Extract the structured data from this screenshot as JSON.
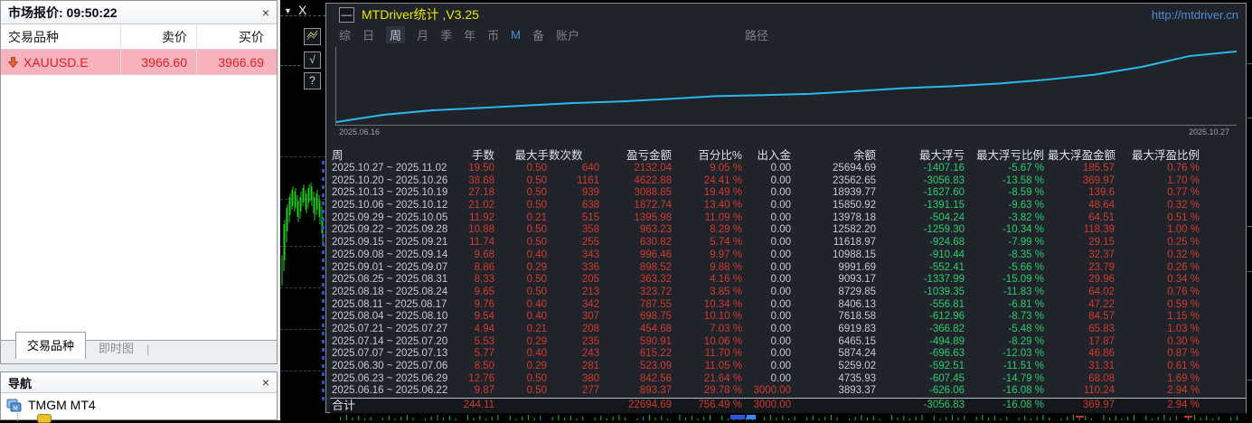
{
  "icons": {
    "close": "×",
    "minimize": "—",
    "dropdown": "▼",
    "window_close": "X",
    "check": "√",
    "help": "?"
  },
  "colors": {
    "accent_red": "#cf3a30",
    "accent_green": "#27cd6e",
    "equity_line": "#29b9ea",
    "title_yellow": "#e8e800",
    "url_blue": "#4a8fd4",
    "quote_row_pink": "#f8b2bd",
    "quote_red": "#de2020"
  },
  "market_watch": {
    "title": "市场报价: 09:50:22",
    "columns": [
      "交易品种",
      "卖价",
      "买价"
    ],
    "quote": {
      "symbol": "XAUUSD.E",
      "sell": "3966.60",
      "buy": "3966.69"
    },
    "tabs": {
      "active": "交易品种",
      "inactive": "即时图"
    }
  },
  "navigator": {
    "title": "导航",
    "items": [
      {
        "label": "TMGM MT4"
      }
    ]
  },
  "mtdriver": {
    "title": "MTDriver统计 ,V3.25",
    "url": "http://mtdriver.cn",
    "toolbar": [
      "综",
      "日",
      "周",
      "月",
      "季",
      "年",
      "币",
      "M",
      "备",
      "账户"
    ],
    "toolbar_active": "周",
    "toolbar_path": "路径",
    "chart_dates": {
      "start": "2025.06.16",
      "end": "2025.10.27"
    },
    "table": {
      "headers": [
        {
          "label": "周",
          "span": 1
        },
        {
          "label": "手数",
          "span": 1
        },
        {
          "label": "最大手数次数",
          "span": 2
        },
        {
          "label": "盈亏金额",
          "span": 1
        },
        {
          "label": "百分比%",
          "span": 1
        },
        {
          "label": "出入金",
          "span": 1
        },
        {
          "label": "余额",
          "span": 1
        },
        {
          "label": "最大浮亏",
          "span": 1
        },
        {
          "label": "最大浮亏比例",
          "span": 1
        },
        {
          "label": "最大浮盈金额",
          "span": 1
        },
        {
          "label": "最大浮盈比例",
          "span": 1
        }
      ],
      "col_classes": [
        "date",
        "red",
        "red",
        "red",
        "red",
        "red",
        "white",
        "white",
        "green",
        "green",
        "red",
        "red"
      ],
      "rows": [
        [
          "2025.10.27 ~ 2025.11.02",
          "19.50",
          "0.50",
          "640",
          "2132.04",
          "9.05 %",
          "0.00",
          "25694.69",
          "-1407.16",
          "-5.67 %",
          "185.57",
          "0.76 %"
        ],
        [
          "2025.10.20 ~ 2025.10.26",
          "38.68",
          "0.50",
          "1161",
          "4622.88",
          "24.41 %",
          "0.00",
          "23562.65",
          "-3056.83",
          "-13.58 %",
          "369.97",
          "1.70 %"
        ],
        [
          "2025.10.13 ~ 2025.10.19",
          "27.18",
          "0.50",
          "939",
          "3088.85",
          "19.49 %",
          "0.00",
          "18939.77",
          "-1627.60",
          "-8.59 %",
          "139.6",
          "0.77 %"
        ],
        [
          "2025.10.06 ~ 2025.10.12",
          "21.02",
          "0.50",
          "638",
          "1872.74",
          "13.40 %",
          "0.00",
          "15850.92",
          "-1391.15",
          "-9.63 %",
          "48.64",
          "0.32 %"
        ],
        [
          "2025.09.29 ~ 2025.10.05",
          "11.92",
          "0.21",
          "515",
          "1395.98",
          "11.09 %",
          "0.00",
          "13978.18",
          "-504.24",
          "-3.82 %",
          "64.51",
          "0.51 %"
        ],
        [
          "2025.09.22 ~ 2025.09.28",
          "10.88",
          "0.50",
          "358",
          "963.23",
          "8.29 %",
          "0.00",
          "12582.20",
          "-1259.30",
          "-10.34 %",
          "118.39",
          "1.00 %"
        ],
        [
          "2025.09.15 ~ 2025.09.21",
          "11.74",
          "0.50",
          "255",
          "630.82",
          "5.74 %",
          "0.00",
          "11618.97",
          "-924.68",
          "-7.99 %",
          "29.15",
          "0.25 %"
        ],
        [
          "2025.09.08 ~ 2025.09.14",
          "9.68",
          "0.40",
          "343",
          "996.46",
          "9.97 %",
          "0.00",
          "10988.15",
          "-910.44",
          "-8.35 %",
          "32.37",
          "0.32 %"
        ],
        [
          "2025.09.01 ~ 2025.09.07",
          "8.86",
          "0.29",
          "336",
          "898.52",
          "9.88 %",
          "0.00",
          "9991.69",
          "-552.41",
          "-5.66 %",
          "23.79",
          "0.26 %"
        ],
        [
          "2025.08.25 ~ 2025.08.31",
          "8.33",
          "0.50",
          "205",
          "363.32",
          "4.16 %",
          "0.00",
          "9093.17",
          "-1337.99",
          "-15.09 %",
          "29.96",
          "0.34 %"
        ],
        [
          "2025.08.18 ~ 2025.08.24",
          "9.65",
          "0.50",
          "213",
          "323.72",
          "3.85 %",
          "0.00",
          "8729.85",
          "-1039.35",
          "-11.83 %",
          "64.02",
          "0.76 %"
        ],
        [
          "2025.08.11 ~ 2025.08.17",
          "9.76",
          "0.40",
          "342",
          "787.55",
          "10.34 %",
          "0.00",
          "8406.13",
          "-556.81",
          "-6.81 %",
          "47.22",
          "0.59 %"
        ],
        [
          "2025.08.04 ~ 2025.08.10",
          "9.54",
          "0.40",
          "307",
          "698.75",
          "10.10 %",
          "0.00",
          "7618.58",
          "-612.96",
          "-8.73 %",
          "84.57",
          "1.15 %"
        ],
        [
          "2025.07.21 ~ 2025.07.27",
          "4.94",
          "0.21",
          "208",
          "454.68",
          "7.03 %",
          "0.00",
          "6919.83",
          "-366.82",
          "-5.48 %",
          "65.83",
          "1.03 %"
        ],
        [
          "2025.07.14 ~ 2025.07.20",
          "5.53",
          "0.29",
          "235",
          "590.91",
          "10.06 %",
          "0.00",
          "6465.15",
          "-494.89",
          "-8.29 %",
          "17.87",
          "0.30 %"
        ],
        [
          "2025.07.07 ~ 2025.07.13",
          "5.77",
          "0.40",
          "243",
          "615.22",
          "11.70 %",
          "0.00",
          "5874.24",
          "-696.63",
          "-12.03 %",
          "46.86",
          "0.87 %"
        ],
        [
          "2025.06.30 ~ 2025.07.06",
          "8.50",
          "0.29",
          "281",
          "523.09",
          "11.05 %",
          "0.00",
          "5259.02",
          "-592.51",
          "-11.51 %",
          "31.31",
          "0.61 %"
        ],
        [
          "2025.06.23 ~ 2025.06.29",
          "12.76",
          "0.50",
          "380",
          "842.56",
          "21.64 %",
          "0.00",
          "4735.93",
          "-607.45",
          "-14.79 %",
          "68.08",
          "1.69 %"
        ],
        [
          "2025.06.16 ~ 2025.06.22",
          "9.87",
          "0.50",
          "277",
          "893.37",
          "29.78 %",
          "3000.00",
          "3893.37",
          "-626.06",
          "-16.08 %",
          "110.24",
          "2.94 %"
        ]
      ],
      "total": [
        "合计",
        "244.11",
        "",
        "",
        "22694.69",
        "756.49 %",
        "3000.00",
        "",
        "-3056.83",
        "-16.08 %",
        "369.97",
        "2.94 %"
      ]
    }
  },
  "chart_data": {
    "type": "line",
    "title": "MTDriver equity curve",
    "line_color": "#29b9ea",
    "x_labels_shown": [
      "2025.06.16",
      "2025.10.27"
    ],
    "start_value": 3000.0,
    "x": [
      "2025.06.16",
      "2025.06.23",
      "2025.06.30",
      "2025.07.07",
      "2025.07.14",
      "2025.07.21",
      "2025.08.04",
      "2025.08.11",
      "2025.08.18",
      "2025.08.25",
      "2025.09.01",
      "2025.09.08",
      "2025.09.15",
      "2025.09.22",
      "2025.09.29",
      "2025.10.06",
      "2025.10.13",
      "2025.10.20",
      "2025.10.27"
    ],
    "balances": [
      3893.37,
      4735.93,
      5259.02,
      5874.24,
      6465.15,
      6919.83,
      7618.58,
      8406.13,
      8729.85,
      9093.17,
      9991.69,
      10988.15,
      11618.97,
      12582.2,
      13978.18,
      15850.92,
      18939.77,
      23562.65,
      25694.69
    ]
  }
}
